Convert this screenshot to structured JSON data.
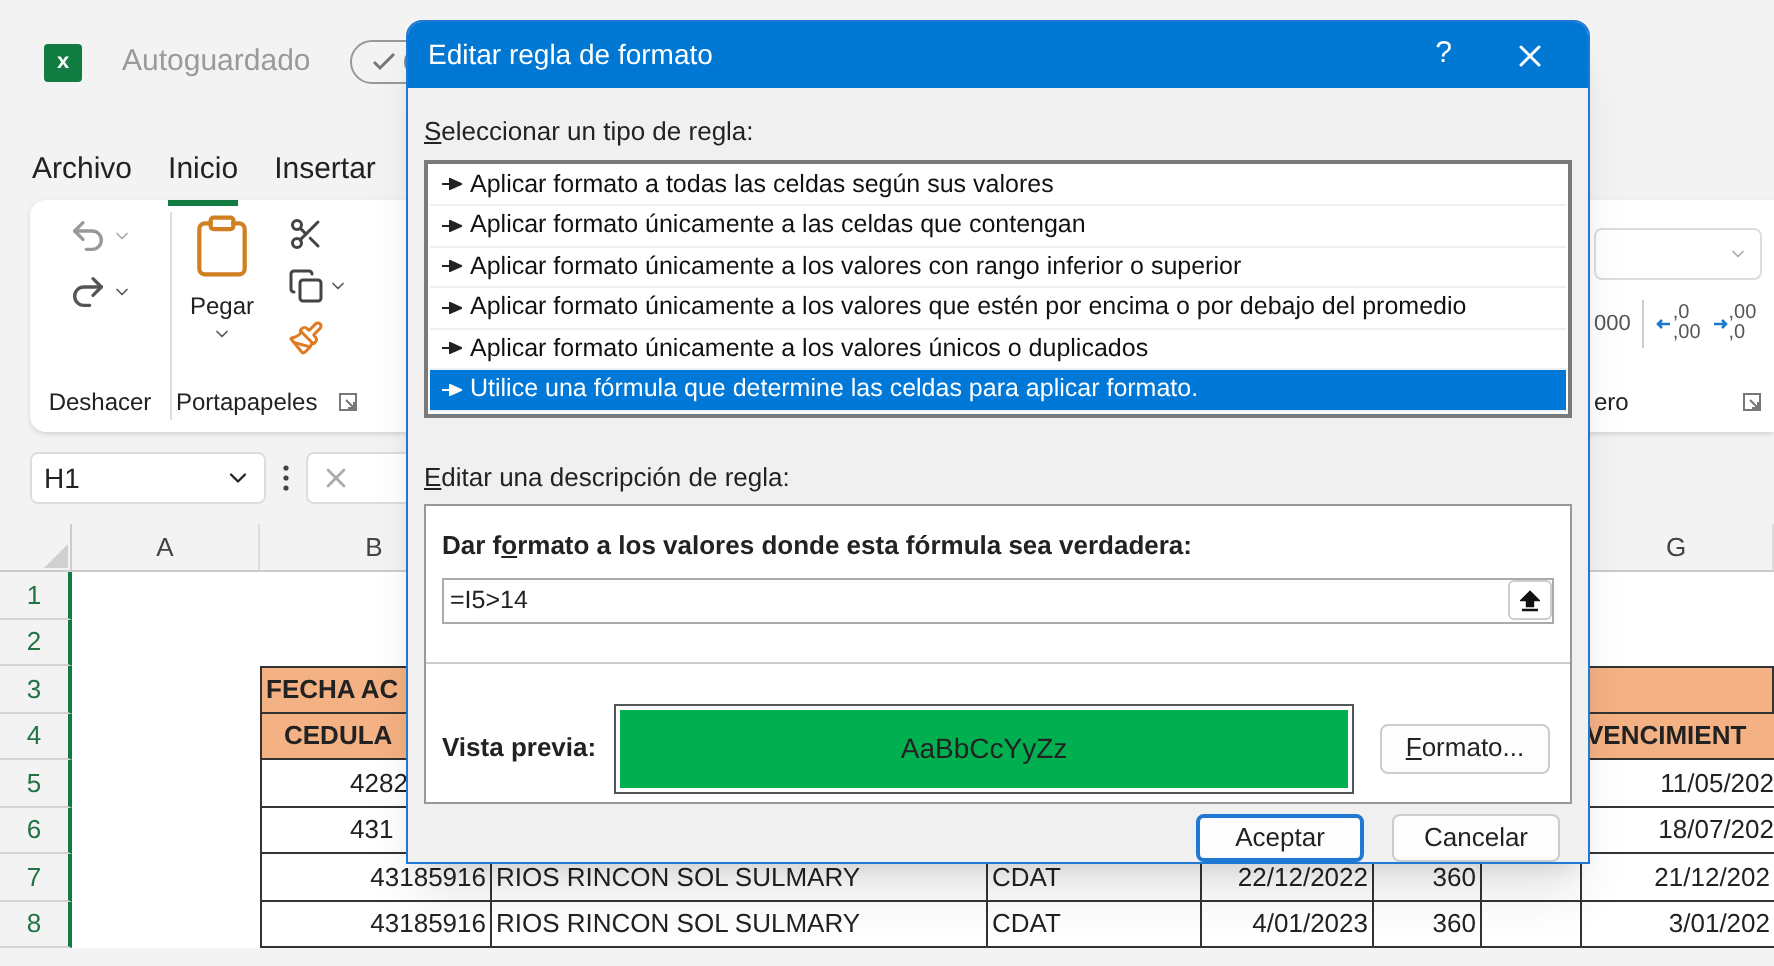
{
  "excel": {
    "app_icon_letter": "x",
    "autosave_label": "Autoguardado",
    "autosave_on": true,
    "ribbon_tabs": [
      {
        "label": "Archivo",
        "selected": false
      },
      {
        "label": "Inicio",
        "selected": true
      },
      {
        "label": "Insertar",
        "selected": false
      }
    ],
    "paste_label": "Pegar",
    "group_labels": [
      "Deshacer",
      "Portapapeles"
    ],
    "number_group": {
      "thousands": "000",
      "decimals": [
        {
          "top": ",0",
          "bottom": ",00"
        },
        {
          "top": ",00",
          "bottom": ",0"
        }
      ],
      "label": "ero"
    },
    "name_box": "H1"
  },
  "sheet": {
    "column_headers": [
      {
        "label": "A"
      },
      {
        "label": "B"
      },
      {
        "label": "G"
      }
    ],
    "rows": [
      {
        "number": "1",
        "kind": "blank"
      },
      {
        "number": "2",
        "kind": "blank"
      },
      {
        "number": "3",
        "kind": "title",
        "b": "FECHA AC"
      },
      {
        "number": "4",
        "kind": "header",
        "b": "CEDULA",
        "g": "VENCIMIENT"
      },
      {
        "number": "5",
        "kind": "partial",
        "b": "4282",
        "g": "11/05/202"
      },
      {
        "number": "6",
        "kind": "partial",
        "b": "431",
        "g": "18/07/202"
      },
      {
        "number": "7",
        "kind": "full",
        "cells": [
          "43185916",
          "RIOS RINCON SOL SULMARY",
          "CDAT",
          "22/12/2022",
          "360",
          "",
          "21/12/202"
        ]
      },
      {
        "number": "8",
        "kind": "full",
        "cells": [
          "43185916",
          "RIOS RINCON SOL SULMARY",
          "CDAT",
          "4/01/2023",
          "360",
          "",
          "3/01/202"
        ]
      }
    ]
  },
  "dialog": {
    "title": "Editar regla de formato",
    "help": "?",
    "rule_type_label": {
      "accel": "S",
      "rest": "eleccionar un tipo de regla:"
    },
    "rule_types": [
      {
        "text": "Aplicar formato a todas las celdas según sus valores",
        "selected": false
      },
      {
        "text": "Aplicar formato únicamente a las celdas que contengan",
        "selected": false
      },
      {
        "text": "Aplicar formato únicamente a los valores con rango inferior o superior",
        "selected": false
      },
      {
        "text": "Aplicar formato únicamente a los valores que estén por encima o por debajo del promedio",
        "selected": false
      },
      {
        "text": "Aplicar formato únicamente a los valores únicos o duplicados",
        "selected": false
      },
      {
        "text": "Utilice una fórmula que determine las celdas para aplicar formato.",
        "selected": true
      }
    ],
    "description_label": {
      "accel": "E",
      "rest": "ditar una descripción de regla:"
    },
    "formula_label": {
      "lead": "Dar f",
      "accel": "o",
      "rest": "rmato a los valores donde esta fórmula sea verdadera:"
    },
    "formula_value": "=I5>14",
    "preview_label": "Vista previa:",
    "preview_sample": "AaBbCcYyZz",
    "format_button": {
      "accel": "F",
      "rest": "ormato..."
    },
    "buttons": [
      {
        "label": "Aceptar",
        "default": true
      },
      {
        "label": "Cancelar",
        "default": false
      }
    ]
  }
}
